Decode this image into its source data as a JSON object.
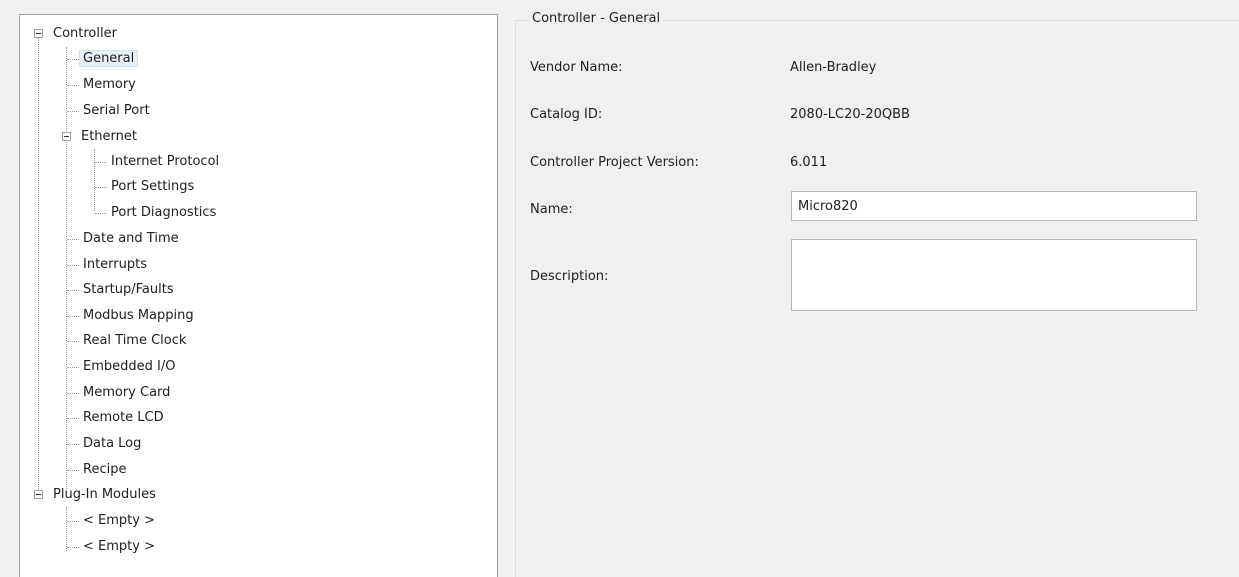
{
  "tree": {
    "root_label": "Controller",
    "items": [
      "General",
      "Memory",
      "Serial Port",
      "Ethernet",
      "Internet Protocol",
      "Port Settings",
      "Port Diagnostics",
      "Date and Time",
      "Interrupts",
      "Startup/Faults",
      "Modbus Mapping",
      "Real Time Clock",
      "Embedded I/O",
      "Memory Card",
      "Remote LCD",
      "Data Log",
      "Recipe"
    ],
    "plugin_label": "Plug-In Modules",
    "plugin_items": [
      "< Empty >",
      "< Empty >"
    ],
    "selected": "General"
  },
  "panel": {
    "title": "Controller - General",
    "vendor_label": "Vendor Name:",
    "vendor_value": "Allen-Bradley",
    "catalog_label": "Catalog ID:",
    "catalog_value": "2080-LC20-20QBB",
    "version_label": "Controller Project Version:",
    "version_value": "6.011",
    "name_label": "Name:",
    "name_value": "Micro820",
    "description_label": "Description:",
    "description_value": ""
  }
}
